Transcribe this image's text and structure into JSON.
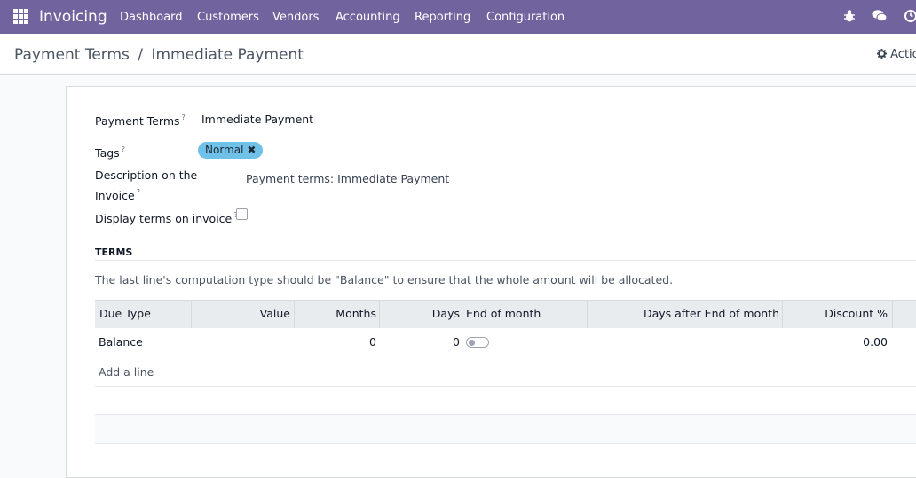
{
  "navbar": {
    "brand": "Invoicing",
    "menu": [
      {
        "label": "Dashboard"
      },
      {
        "label": "Customers"
      },
      {
        "label": "Vendors"
      },
      {
        "label": "Accounting"
      },
      {
        "label": "Reporting"
      },
      {
        "label": "Configuration"
      }
    ],
    "icons": [
      "bug-icon",
      "chat-icon",
      "clock-icon"
    ]
  },
  "breadcrumb": {
    "parent": "Payment Terms",
    "separator": "/",
    "current": "Immediate Payment"
  },
  "actions_label": "Actio",
  "form": {
    "payment_terms_label": "Payment Terms",
    "payment_terms_value": "Immediate Payment",
    "tags_label": "Tags",
    "tag_value": "Normal",
    "description_label_line1": "Description on the",
    "description_label_line2": "Invoice",
    "description_value": "Payment terms: Immediate Payment",
    "display_terms_label": "Display terms on invoice",
    "display_terms_checked": false,
    "tooltip_mark": "?"
  },
  "terms": {
    "section_title": "TERMS",
    "hint": "The last line's computation type should be \"Balance\" to ensure that the whole amount will be allocated.",
    "columns": [
      "Due Type",
      "Value",
      "Months",
      "Days",
      "End of month",
      "Days after End of month",
      "Discount %"
    ],
    "rows": [
      {
        "due_type": "Balance",
        "value": "",
        "months": "0",
        "days": "0",
        "end_of_month": false,
        "days_after": "",
        "discount": "0.00"
      }
    ],
    "add_line": "Add a line"
  },
  "colors": {
    "navbar": "#71639e",
    "tag": "#6fc1e8"
  }
}
